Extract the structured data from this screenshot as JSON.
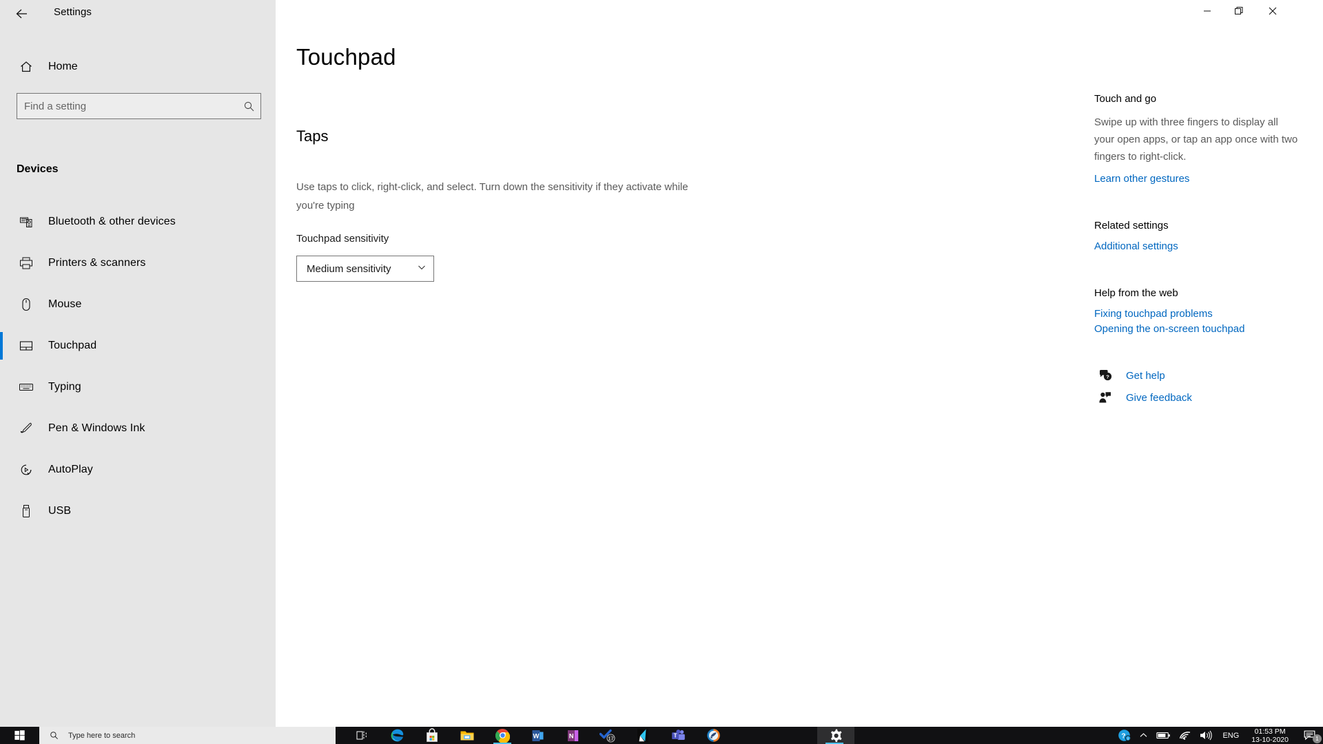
{
  "window": {
    "title": "Settings",
    "back_icon": "back-arrow-icon",
    "minimize_label": "–",
    "maximize_label": "❐",
    "close_label": "✕"
  },
  "sidebar": {
    "home_label": "Home",
    "home_icon": "home-icon",
    "search": {
      "placeholder": "Find a setting",
      "value": "",
      "icon": "search-icon"
    },
    "group_label": "Devices",
    "items": [
      {
        "label": "Bluetooth & other devices",
        "icon": "bluetooth-devices-icon",
        "selected": false
      },
      {
        "label": "Printers & scanners",
        "icon": "printer-icon",
        "selected": false
      },
      {
        "label": "Mouse",
        "icon": "mouse-icon",
        "selected": false
      },
      {
        "label": "Touchpad",
        "icon": "touchpad-icon",
        "selected": true
      },
      {
        "label": "Typing",
        "icon": "keyboard-icon",
        "selected": false
      },
      {
        "label": "Pen & Windows Ink",
        "icon": "pen-icon",
        "selected": false
      },
      {
        "label": "AutoPlay",
        "icon": "autoplay-icon",
        "selected": false
      },
      {
        "label": "USB",
        "icon": "usb-icon",
        "selected": false
      }
    ]
  },
  "main": {
    "page_title": "Touchpad",
    "section_title": "Taps",
    "section_desc": "Use taps to click, right-click, and select. Turn down the sensitivity if they activate while you're typing",
    "dropdown_label": "Touchpad sensitivity",
    "dropdown_value": "Medium sensitivity",
    "dropdown_icon": "chevron-down-icon"
  },
  "right_panel": {
    "touch_and_go_heading": "Touch and go",
    "touch_and_go_body": "Swipe up with three fingers to display all your open apps, or tap an app once with two fingers to right-click.",
    "learn_gestures_link": "Learn other gestures",
    "related_settings_heading": "Related settings",
    "additional_settings_link": "Additional settings",
    "help_web_heading": "Help from the web",
    "help_links": [
      "Fixing touchpad problems",
      "Opening the on-screen touchpad"
    ],
    "get_help_label": "Get help",
    "get_help_icon": "question-bubble-icon",
    "give_feedback_label": "Give feedback",
    "give_feedback_icon": "feedback-person-icon"
  },
  "taskbar": {
    "start_icon": "windows-start-icon",
    "search_placeholder": "Type here to search",
    "search_icon": "search-icon",
    "task_view_icon": "task-view-icon",
    "apps": [
      {
        "name": "Microsoft Edge",
        "icon": "edge-icon",
        "running": false
      },
      {
        "name": "Microsoft Store",
        "icon": "store-icon",
        "running": false
      },
      {
        "name": "File Explorer",
        "icon": "file-explorer-icon",
        "running": false
      },
      {
        "name": "Google Chrome",
        "icon": "chrome-icon",
        "running": true
      },
      {
        "name": "Word",
        "icon": "word-icon",
        "running": false
      },
      {
        "name": "OneNote",
        "icon": "onenote-icon",
        "running": false
      },
      {
        "name": "Microsoft To Do",
        "icon": "todo-icon",
        "running": false,
        "badge": "17"
      },
      {
        "name": "Kite",
        "icon": "kite-icon",
        "running": false
      },
      {
        "name": "Microsoft Teams",
        "icon": "teams-icon",
        "running": false
      },
      {
        "name": "Rocket browser",
        "icon": "rocket-icon",
        "running": false
      },
      {
        "name": "Settings",
        "icon": "gear-icon",
        "running": true
      }
    ],
    "tray": {
      "help_icon": "help-circle-icon",
      "chevron_icon": "chevron-up-icon",
      "battery_icon": "battery-icon",
      "network_icon": "wifi-icon",
      "volume_icon": "speaker-icon",
      "language": "ENG",
      "time": "01:53 PM",
      "date": "13-10-2020",
      "notification_icon": "notification-icon",
      "notification_count": "1"
    }
  },
  "colors": {
    "accent": "#0078d7",
    "link": "#0067c0",
    "sidebar_bg": "#e6e6e6",
    "taskbar_bg": "#111113"
  }
}
